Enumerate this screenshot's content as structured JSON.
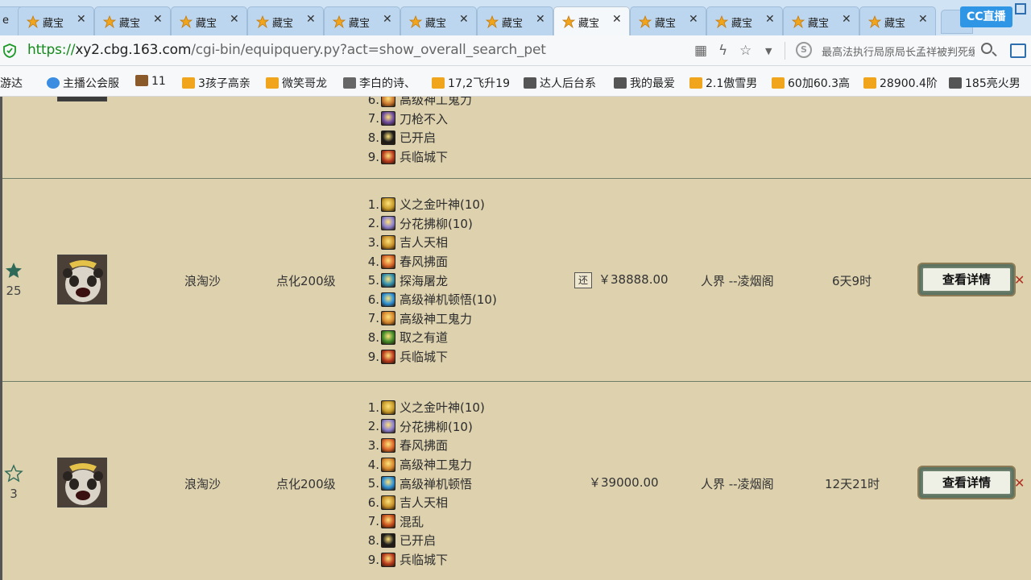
{
  "browser": {
    "tabs": [
      {
        "title": "藏宝",
        "active": false
      },
      {
        "title": "藏宝",
        "active": false
      },
      {
        "title": "藏宝",
        "active": false
      },
      {
        "title": "藏宝",
        "active": false
      },
      {
        "title": "藏宝",
        "active": false
      },
      {
        "title": "藏宝",
        "active": false
      },
      {
        "title": "藏宝",
        "active": false
      },
      {
        "title": "藏宝",
        "active": true
      },
      {
        "title": "藏宝",
        "active": false
      },
      {
        "title": "藏宝",
        "active": false
      },
      {
        "title": "藏宝",
        "active": false
      },
      {
        "title": "藏宝",
        "active": false
      }
    ],
    "first_tab_fragment": "e",
    "brand_logo": "CC直播",
    "url": {
      "scheme": "https://",
      "host": "xy2.cbg.163.com",
      "path": "/cgi-bin/equipquery.py?act=show_overall_search_pet"
    },
    "search_text": "最高法执行局原局长孟祥被判死缓",
    "bookmarks": [
      "游达",
      "主播公会服",
      "11",
      "3孩子高亲",
      "微笑哥龙",
      "李白的诗、",
      "17,2飞升19",
      "达人后台系",
      "我的最爱",
      "2.1傲雪男",
      "60加60.3高",
      "28900.4阶",
      "185亮火男"
    ]
  },
  "listing": {
    "top_partial_row": {
      "skills": [
        {
          "num": "6.",
          "name": "高级神工鬼力",
          "color": "#c8752e"
        },
        {
          "num": "7.",
          "name": "刀枪不入",
          "color": "#6b4aa0"
        },
        {
          "num": "8.",
          "name": "已开启",
          "color": "#1c1c1c"
        },
        {
          "num": "9.",
          "name": "兵临城下",
          "color": "#b83a1f"
        }
      ]
    },
    "rows": [
      {
        "favorited": true,
        "fav_count": "25",
        "pet_name": "浪淘沙",
        "level": "点化200级",
        "return_badge": "还",
        "price": "￥38888.00",
        "server": "人界 --凌烟阁",
        "time_left": "6天9时",
        "button": "查看详情",
        "skills": [
          {
            "num": "1.",
            "name": "义之金叶神(10)",
            "color": "#c79b2a"
          },
          {
            "num": "2.",
            "name": "分花拂柳(10)",
            "color": "#8a7fd0"
          },
          {
            "num": "3.",
            "name": "吉人天相",
            "color": "#c7902a"
          },
          {
            "num": "4.",
            "name": "春风拂面",
            "color": "#d9652a"
          },
          {
            "num": "5.",
            "name": "探海屠龙",
            "color": "#2f8fb0"
          },
          {
            "num": "6.",
            "name": "高级禅机顿悟(10)",
            "color": "#2a8fd6"
          },
          {
            "num": "7.",
            "name": "高级神工鬼力",
            "color": "#d4852e"
          },
          {
            "num": "8.",
            "name": "取之有道",
            "color": "#3f8a2a"
          },
          {
            "num": "9.",
            "name": "兵临城下",
            "color": "#b83a1f"
          }
        ]
      },
      {
        "favorited": false,
        "fav_count": "3",
        "pet_name": "浪淘沙",
        "level": "点化200级",
        "return_badge": "",
        "price": "￥39000.00",
        "server": "人界 --凌烟阁",
        "time_left": "12天21时",
        "button": "查看详情",
        "skills": [
          {
            "num": "1.",
            "name": "义之金叶神(10)",
            "color": "#c79b2a"
          },
          {
            "num": "2.",
            "name": "分花拂柳(10)",
            "color": "#8a7fd0"
          },
          {
            "num": "3.",
            "name": "春风拂面",
            "color": "#d9652a"
          },
          {
            "num": "4.",
            "name": "高级神工鬼力",
            "color": "#d4852e"
          },
          {
            "num": "5.",
            "name": "高级禅机顿悟",
            "color": "#2a8fd6"
          },
          {
            "num": "6.",
            "name": "吉人天相",
            "color": "#c7902a"
          },
          {
            "num": "7.",
            "name": "混乱",
            "color": "#c8501e"
          },
          {
            "num": "8.",
            "name": "已开启",
            "color": "#1c1c1c"
          },
          {
            "num": "9.",
            "name": "兵临城下",
            "color": "#b83a1f"
          }
        ]
      }
    ]
  }
}
